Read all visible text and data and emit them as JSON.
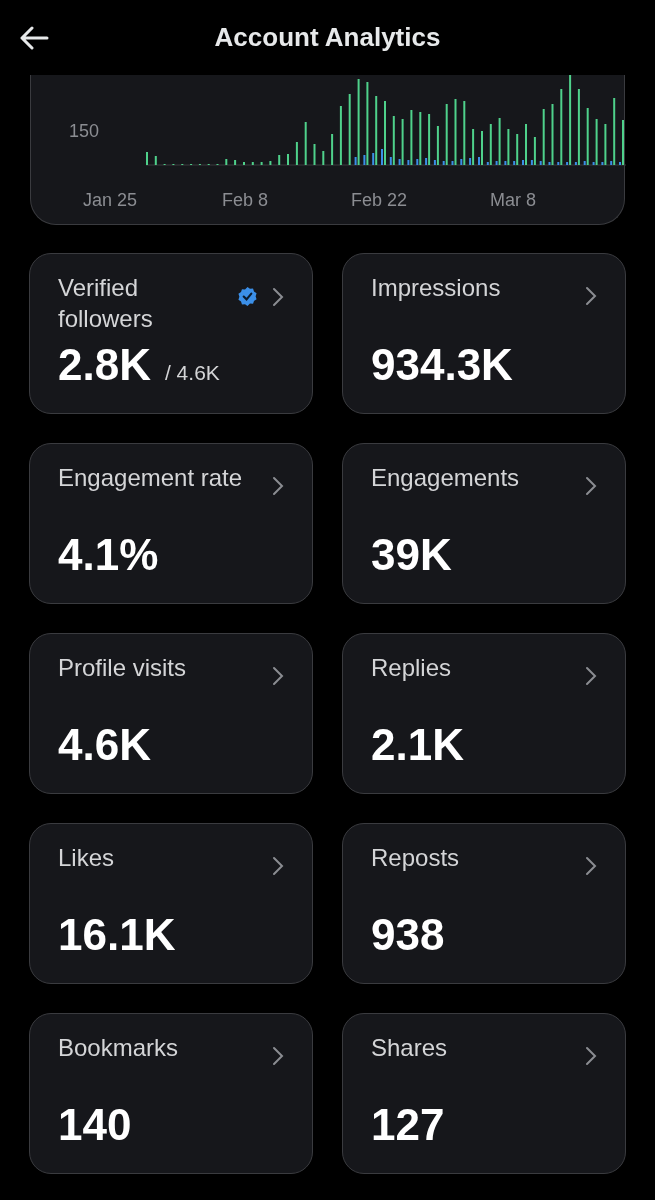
{
  "header": {
    "title": "Account Analytics"
  },
  "chart": {
    "y_tick": "150",
    "x_labels": [
      "Jan 25",
      "Feb 8",
      "Feb 22",
      "Mar 8"
    ]
  },
  "metrics": [
    {
      "label": "Verified followers",
      "value": "2.8K",
      "total": "/ 4.6K",
      "verified": true
    },
    {
      "label": "Impressions",
      "value": "934.3K",
      "verified": false
    },
    {
      "label": "Engagement rate",
      "value": "4.1%",
      "verified": false
    },
    {
      "label": "Engagements",
      "value": "39K",
      "verified": false
    },
    {
      "label": "Profile visits",
      "value": "4.6K",
      "verified": false
    },
    {
      "label": "Replies",
      "value": "2.1K",
      "verified": false
    },
    {
      "label": "Likes",
      "value": "16.1K",
      "verified": false
    },
    {
      "label": "Reposts",
      "value": "938",
      "verified": false
    },
    {
      "label": "Bookmarks",
      "value": "140",
      "verified": false
    },
    {
      "label": "Shares",
      "value": "127",
      "verified": false
    }
  ]
}
